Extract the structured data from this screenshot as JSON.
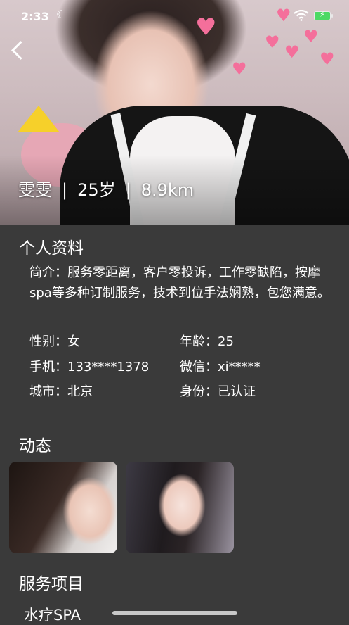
{
  "status_bar": {
    "time": "2:33"
  },
  "profile": {
    "name": "雯雯",
    "age_text": "25岁",
    "distance": "8.9km",
    "separator": "|"
  },
  "sections": {
    "info_title": "个人资料",
    "moments_title": "动态",
    "services_title": "服务项目"
  },
  "bio": "简介：服务零距离，客户零投诉，工作零缺陷，按摩spa等多种订制服务，技术到位手法娴熟，包您满意。",
  "fields": {
    "gender": "性别：女",
    "age": "年龄：25",
    "phone": "手机：133****1378",
    "wechat": "微信：xi*****",
    "city": "城市：北京",
    "identity": "身份：已认证"
  },
  "services": [
    "水疗SPA"
  ],
  "colors": {
    "background": "#3a3a3a",
    "battery": "#4cd964"
  },
  "icons": [
    "moon-icon",
    "wifi-icon",
    "battery-icon",
    "back-arrow-icon"
  ]
}
